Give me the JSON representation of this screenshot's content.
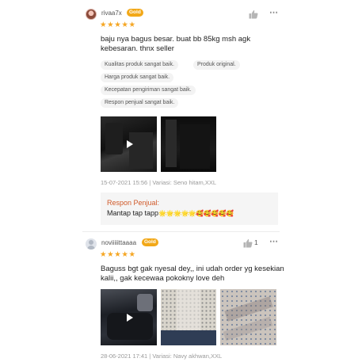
{
  "reviews": [
    {
      "username": "rivaa7x",
      "badge": "Gold",
      "stars": "★★★★★",
      "rating": 5,
      "comment": "baju nya bagus besar. buat bb 85kg msh agk kebesaran. thnx seller",
      "tags": [
        "Kualitas produk sangat baik.",
        "Produk original.",
        "Harga produk sangat baik.",
        "Kecepatan pengiriman sangat baik.",
        "Respon penjual sangat baik."
      ],
      "meta": "15-07-2021 15:56 | Variasi: Seno hitam,XXL",
      "seller_response": {
        "title": "Respon Penjual:",
        "text": "Mantap tap tapp",
        "emojis": "🌟🌟🌟🌟🌟🥰🥰🥰🥰🥰"
      },
      "more_icon": "⋯"
    },
    {
      "username": "noviiiiittaaaa",
      "badge": "Gold",
      "stars": "★★★★★",
      "rating": 5,
      "like_count": "1",
      "comment": "Baguss bgt gak nyesal dey,, ini udah order yg kesekian kalii,, gak kecewaa pokokny love deh",
      "meta": "28-06-2021 17:41 | Variasi: Navy akhwan,XXL",
      "more_icon": "⋯"
    }
  ],
  "colors": {
    "badge": "#f2a818",
    "star": "#f5a623",
    "seller_title": "#444444"
  }
}
